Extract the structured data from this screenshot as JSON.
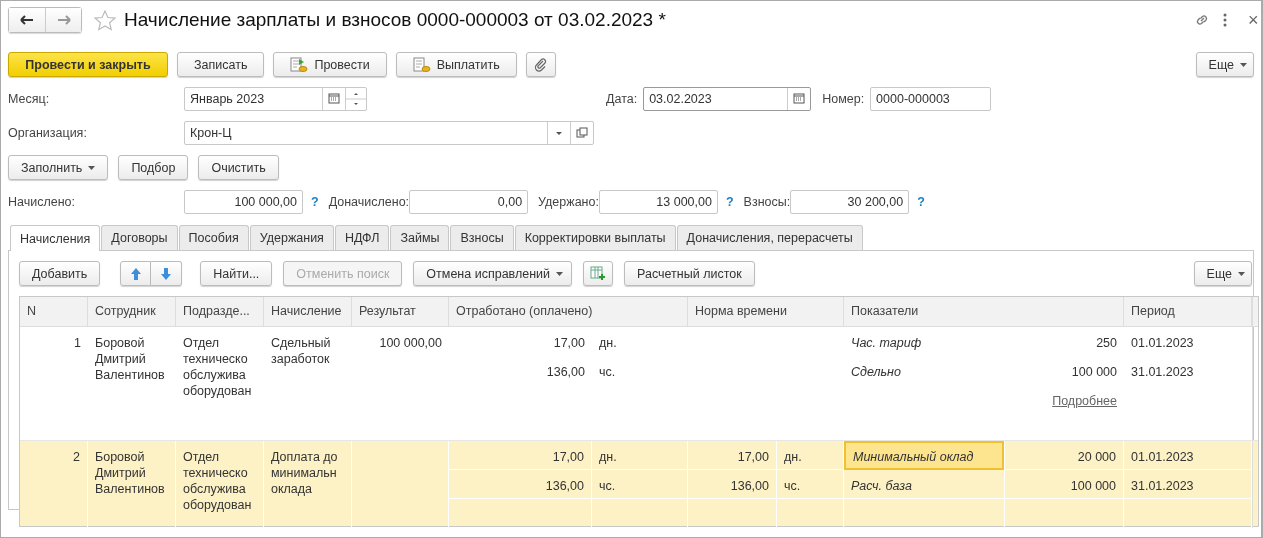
{
  "window": {
    "title": "Начисление зарплаты и взносов 0000-000003 от 03.02.2023 *",
    "close": "×"
  },
  "toolbar": {
    "buttons": [
      {
        "kind": "primary",
        "label": "Провести и закрыть"
      },
      {
        "kind": "plain",
        "label": "Записать"
      },
      {
        "kind": "post",
        "label": "Провести"
      },
      {
        "kind": "pay",
        "label": "Выплатить"
      },
      {
        "kind": "attach"
      }
    ],
    "more": "Еще"
  },
  "header": {
    "month": {
      "label": "Месяц:",
      "value": "Январь 2023"
    },
    "date": {
      "label": "Дата:",
      "value": "03.02.2023"
    },
    "number": {
      "label": "Номер:",
      "value": "0000-000003"
    },
    "organization": {
      "label": "Организация:",
      "value": "Крон-Ц"
    }
  },
  "fill_buttons": [
    {
      "label": "Заполнить",
      "dropdown": true
    },
    {
      "label": "Подбор",
      "dropdown": false
    },
    {
      "label": "Очистить",
      "dropdown": false
    }
  ],
  "totals": [
    {
      "label": "Начислено:",
      "value": "100 000,00",
      "help": "?"
    },
    {
      "label": "Доначислено:",
      "value": "0,00"
    },
    {
      "label": "Удержано:",
      "value": "13 000,00",
      "help": "?"
    },
    {
      "label": "Взносы:",
      "value": "30 200,00",
      "help": "?"
    }
  ],
  "tabs": [
    {
      "label": "Начисления",
      "selected": true
    },
    {
      "label": "Договоры",
      "selected": false
    },
    {
      "label": "Пособия",
      "selected": false
    },
    {
      "label": "Удержания",
      "selected": false
    },
    {
      "label": "НДФЛ",
      "selected": false
    },
    {
      "label": "Займы",
      "selected": false
    },
    {
      "label": "Взносы",
      "selected": false
    },
    {
      "label": "Корректировки выплаты",
      "selected": false
    },
    {
      "label": "Доначисления, перерасчеты",
      "selected": false
    }
  ],
  "table_toolbar": {
    "items": [
      {
        "kind": "button",
        "label": "Добавить",
        "disabled": false
      },
      {
        "kind": "move"
      },
      {
        "kind": "button",
        "label": "Найти...",
        "disabled": false
      },
      {
        "kind": "button",
        "label": "Отменить поиск",
        "disabled": true
      },
      {
        "kind": "menu",
        "label": "Отмена исправлений"
      },
      {
        "kind": "table-add"
      },
      {
        "kind": "button",
        "label": "Расчетный листок",
        "disabled": false
      }
    ],
    "more": "Еще"
  },
  "table": {
    "columns": [
      "N",
      "Сотрудник",
      "Подразде...",
      "Начисление",
      "Результат",
      "Отработано (оплачено)",
      "Норма времени",
      "Показатели",
      "Период"
    ],
    "rows": [
      {
        "selected": false,
        "n": "1",
        "employee": "Боровой Дмитрий Валентинов",
        "department": "Отдел техническо обслужива оборудован",
        "accrual": "Сдельный заработок",
        "result": "100 000,00",
        "worked": [
          {
            "value": "17,00",
            "unit": "дн."
          },
          {
            "value": "136,00",
            "unit": "чс."
          }
        ],
        "indicators": [
          {
            "name": "Час. тариф",
            "value": "250",
            "focused": false
          },
          {
            "name": "Сдельно",
            "value": "100 000",
            "focused": false
          }
        ],
        "period": [
          "01.01.2023",
          "31.01.2023"
        ],
        "details_link": "Подробнее"
      },
      {
        "selected": true,
        "n": "2",
        "employee": "Боровой Дмитрий Валентинов",
        "department": "Отдел техническо обслужива оборудован",
        "accrual": "Доплата до минимальн оклада",
        "worked": [
          {
            "value": "17,00",
            "unit": "дн."
          },
          {
            "value": "136,00",
            "unit": "чс."
          }
        ],
        "norm": [
          {
            "value": "17,00",
            "unit": "дн."
          },
          {
            "value": "136,00",
            "unit": "чс."
          }
        ],
        "indicators": [
          {
            "name": "Минимальный оклад",
            "value": "20 000",
            "focused": true
          },
          {
            "name": "Расч. база",
            "value": "100 000",
            "focused": false
          }
        ],
        "period": [
          "01.01.2023",
          "31.01.2023"
        ]
      }
    ]
  }
}
